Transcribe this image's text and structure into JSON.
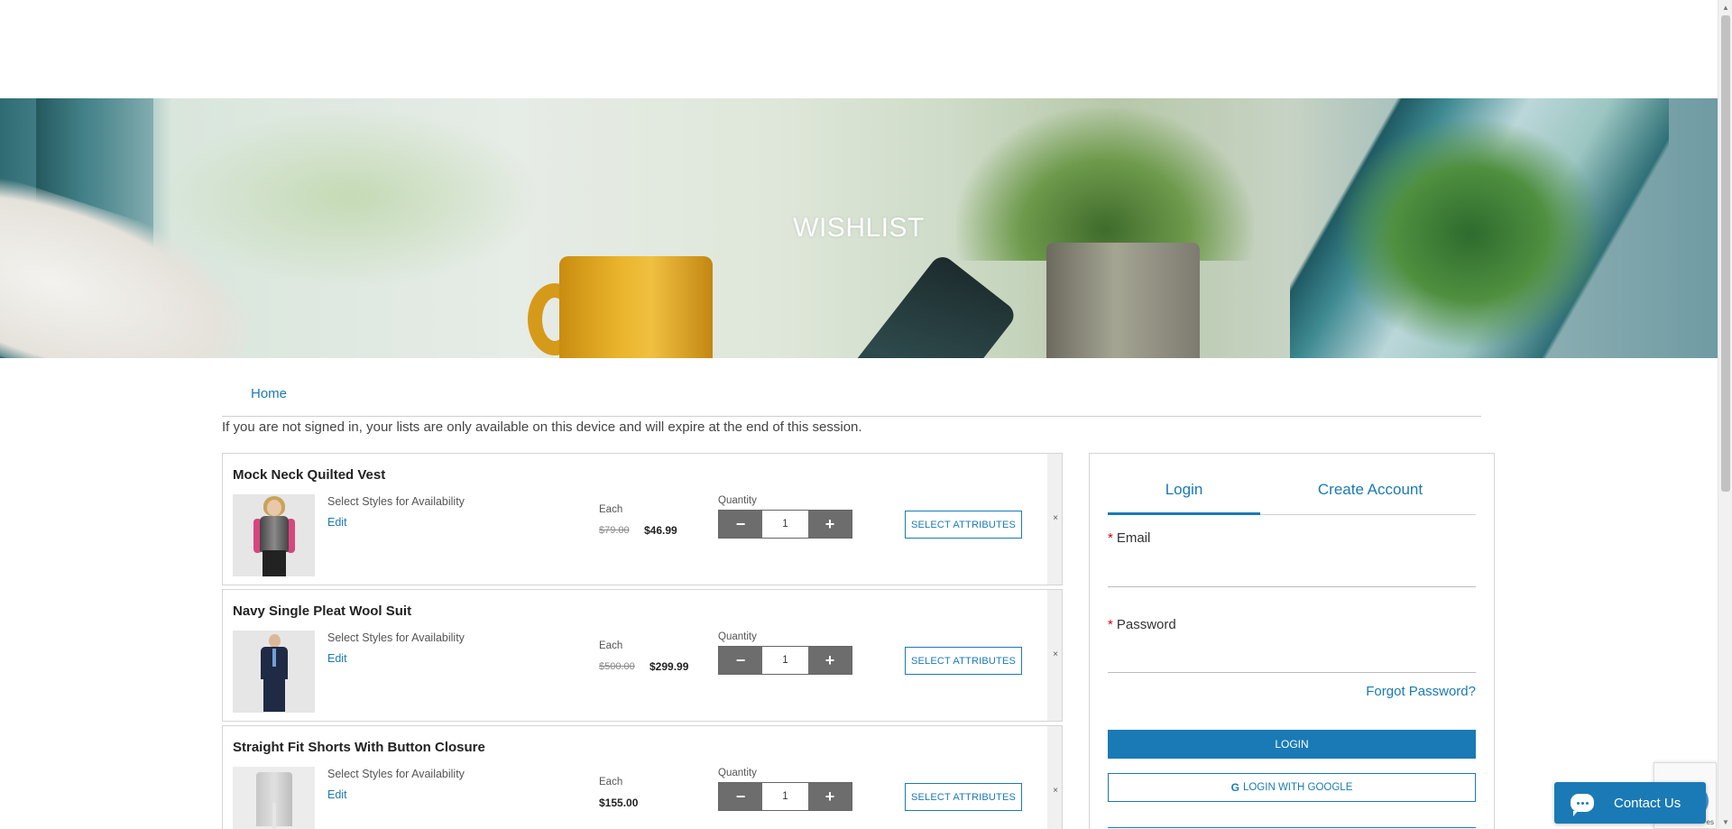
{
  "hero": {
    "title": "WISHLIST"
  },
  "breadcrumb": {
    "home": "Home"
  },
  "notice": "If you are not signed in, your lists are only available on this device and will expire at the end of this session.",
  "labels": {
    "styles": "Select Styles for Availability",
    "edit": "Edit",
    "each": "Each",
    "quantity": "Quantity",
    "select_attributes": "SELECT ATTRIBUTES",
    "minus": "−",
    "plus": "+",
    "remove": "×"
  },
  "items": [
    {
      "name": "Mock Neck Quilted Vest",
      "old_price": "$79.00",
      "price": "$46.99",
      "quantity": "1"
    },
    {
      "name": "Navy Single Pleat Wool Suit",
      "old_price": "$500.00",
      "price": "$299.99",
      "quantity": "1"
    },
    {
      "name": "Straight Fit Shorts With Button Closure",
      "old_price": "",
      "price": "$155.00",
      "quantity": "1"
    }
  ],
  "login": {
    "tab_login": "Login",
    "tab_create": "Create Account",
    "email_label": "Email",
    "password_label": "Password",
    "required_mark": "*",
    "email_value": "",
    "password_value": "",
    "forgot": "Forgot Password?",
    "login_button": "LOGIN",
    "google_g": "G",
    "google_button": "LOGIN WITH GOOGLE"
  },
  "chat": {
    "label": "Contact Us"
  },
  "recaptcha": {
    "tiny": "es"
  },
  "colors": {
    "accent": "#1a7ab5",
    "qty_button": "#6d6d6d",
    "required": "#d0021b"
  }
}
